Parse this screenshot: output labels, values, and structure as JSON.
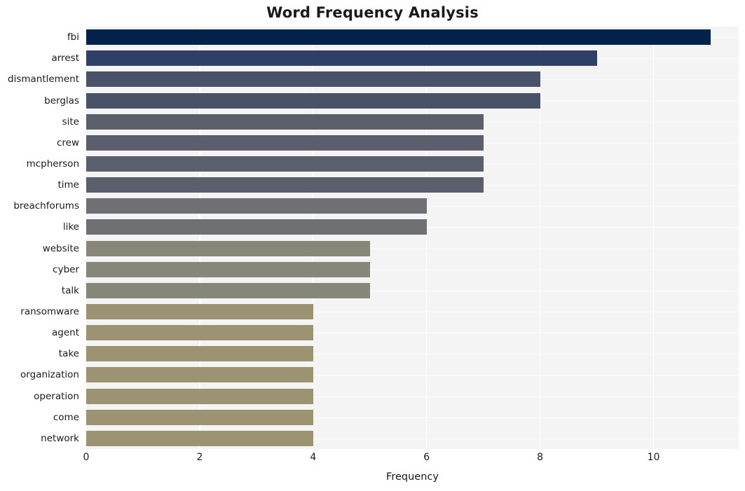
{
  "chart_data": {
    "type": "bar",
    "orientation": "horizontal",
    "title": "Word Frequency Analysis",
    "xlabel": "Frequency",
    "ylabel": "",
    "xlim": [
      0,
      11.5
    ],
    "xticks": [
      0,
      2,
      4,
      6,
      8,
      10
    ],
    "xtick_labels": [
      "0",
      "2",
      "4",
      "6",
      "8",
      "10"
    ],
    "grid": true,
    "grid_axis": "both",
    "legend": null,
    "categories": [
      "fbi",
      "arrest",
      "dismantlement",
      "berglas",
      "site",
      "crew",
      "mcpherson",
      "time",
      "breachforums",
      "like",
      "website",
      "cyber",
      "talk",
      "ransomware",
      "agent",
      "take",
      "organization",
      "operation",
      "come",
      "network"
    ],
    "values": [
      11,
      9,
      8,
      8,
      7,
      7,
      7,
      7,
      6,
      6,
      5,
      5,
      5,
      4,
      4,
      4,
      4,
      4,
      4,
      4
    ],
    "bar_colors": [
      "#02224c",
      "#2f4068",
      "#4a5269",
      "#4a5269",
      "#5b5f6c",
      "#5b5f6c",
      "#5b5f6c",
      "#5b5f6c",
      "#6e7073",
      "#6e7073",
      "#868679",
      "#868679",
      "#868679",
      "#9c9373",
      "#9c9373",
      "#9c9373",
      "#9c9373",
      "#9c9373",
      "#9c9373",
      "#9c9373"
    ],
    "plot_background": "#f4f4f5",
    "figure_background": "#ffffff",
    "gridline_color": "#ffffff",
    "text_color": "#1a1a1a"
  }
}
